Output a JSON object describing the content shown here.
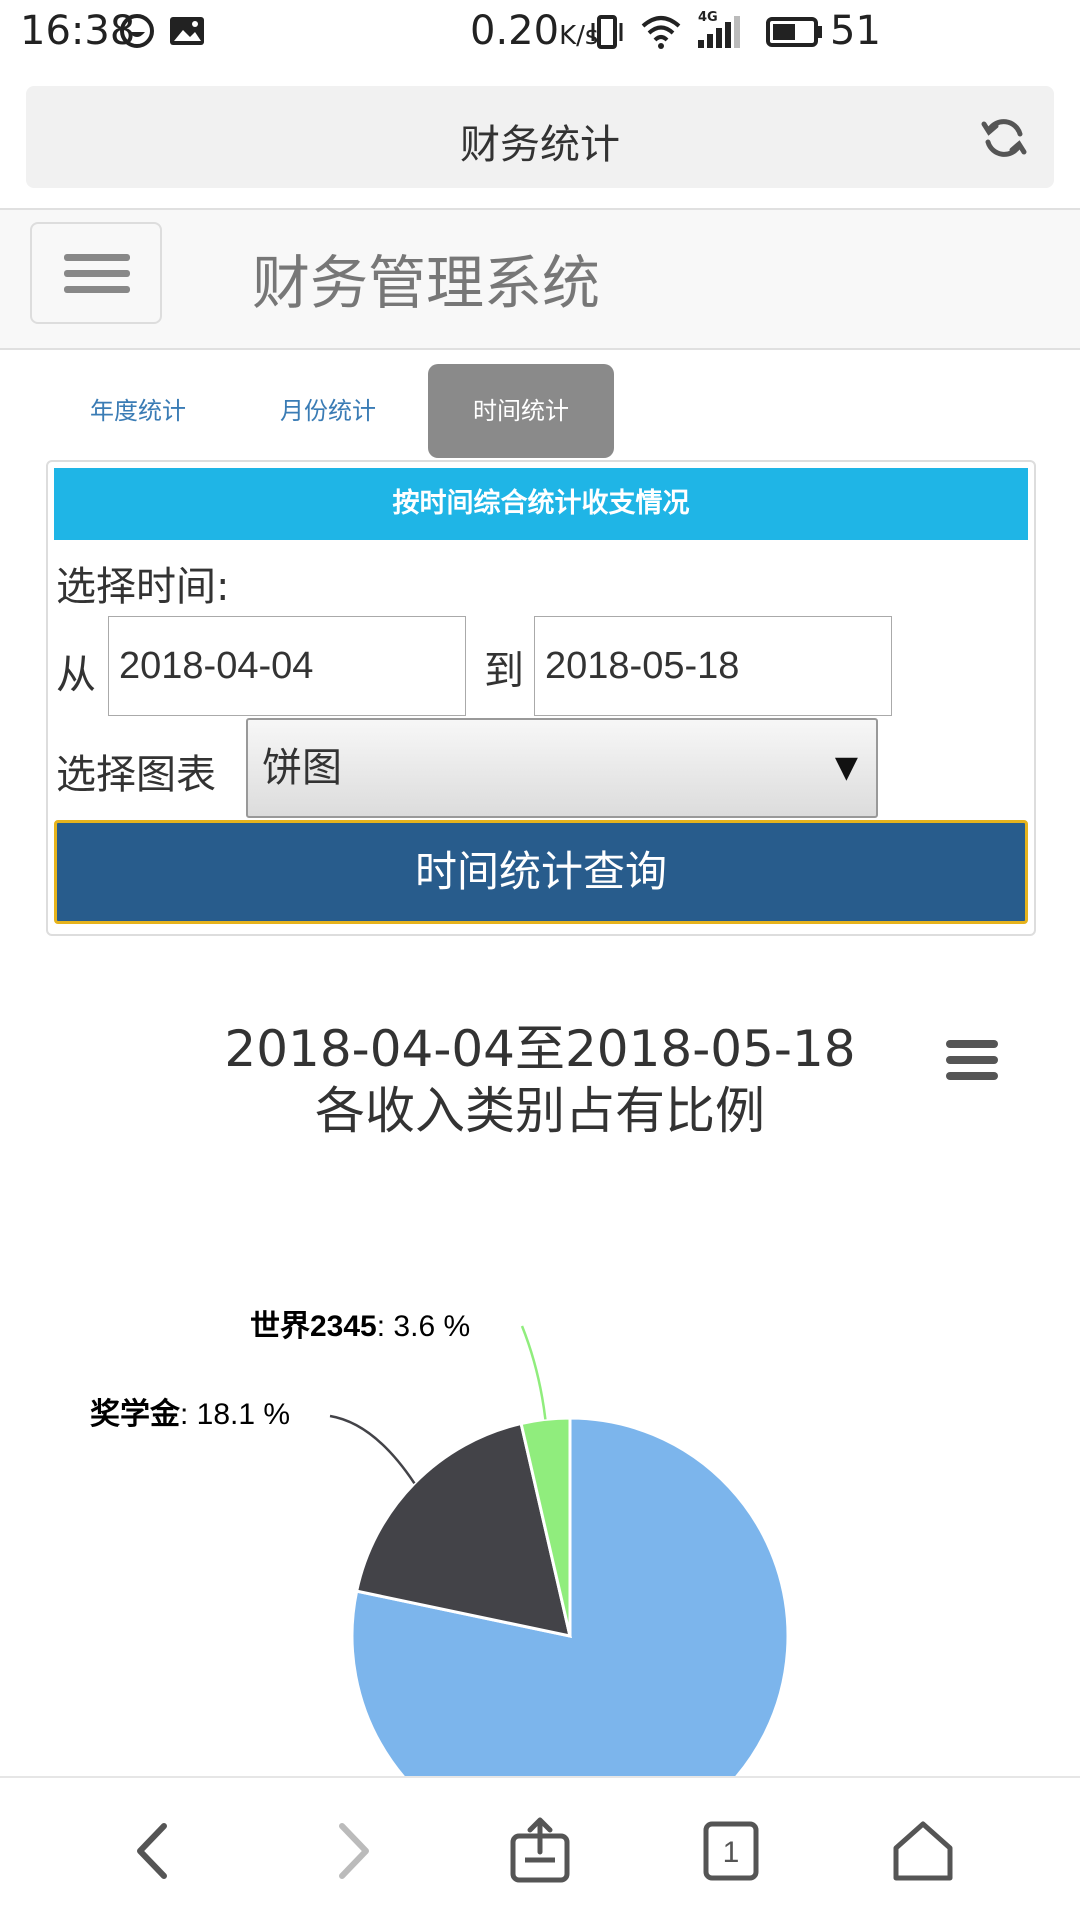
{
  "status_bar": {
    "time": "16:38",
    "network_speed": "0.20",
    "speed_unit": "K/s",
    "network_type": "4G",
    "battery": "51"
  },
  "browser": {
    "page_title": "财务统计"
  },
  "navbar": {
    "brand": "财务管理系统"
  },
  "tabs": [
    {
      "label": "年度统计",
      "active": false
    },
    {
      "label": "月份统计",
      "active": false
    },
    {
      "label": "时间统计",
      "active": true
    }
  ],
  "query_panel": {
    "heading": "按时间综合统计收支情况",
    "select_time_label": "选择时间:",
    "from_label": "从",
    "to_label": "到",
    "from_date": "2018-04-04",
    "to_date": "2018-05-18",
    "chart_type_label": "选择图表",
    "chart_type_value": "饼图",
    "query_button": "时间统计查询"
  },
  "chart_data": {
    "type": "pie",
    "title_line1": "2018-04-04至2018-05-18",
    "title_line2": "各收入类别占有比例",
    "slices": [
      {
        "name": "",
        "value": 78.3,
        "color": "#7cb5ec",
        "label": ""
      },
      {
        "name": "奖学金",
        "value": 18.1,
        "color": "#434348",
        "label": ": 18.1 %"
      },
      {
        "name": "世界2345",
        "value": 3.6,
        "color": "#90ed7d",
        "label": ": 3.6 %"
      }
    ]
  },
  "colors": {
    "header_accent": "#1fb5e6",
    "button_bg": "#285c8c",
    "button_border": "#e6b31d",
    "tab_active_bg": "#8a8a8a"
  }
}
